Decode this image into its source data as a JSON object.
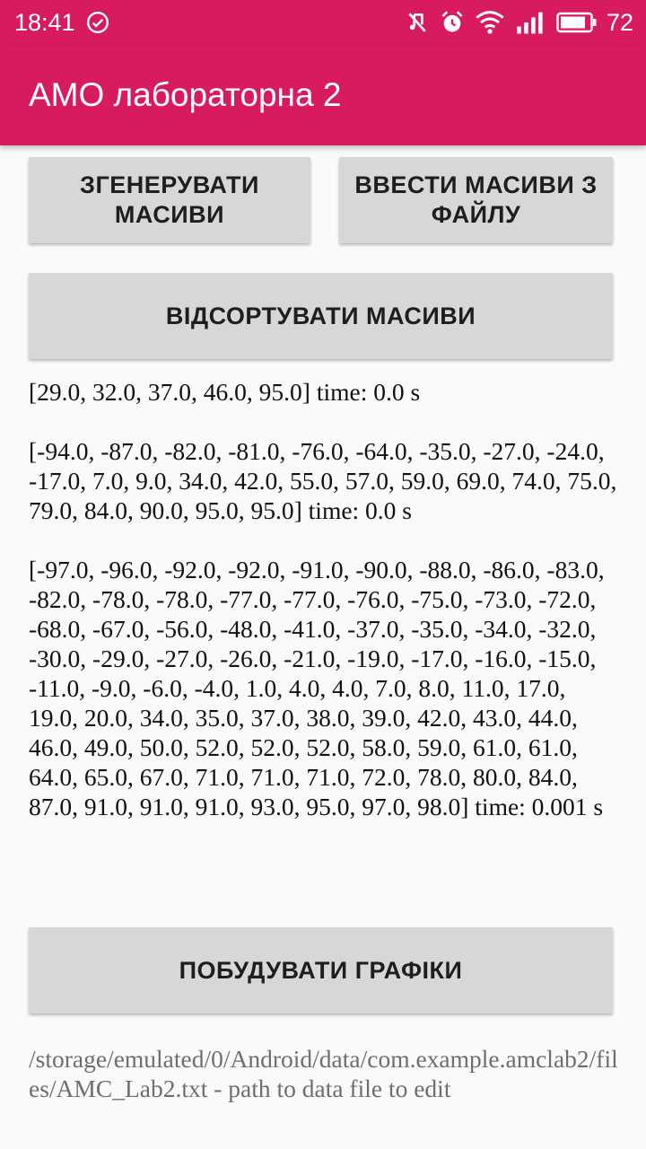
{
  "status_bar": {
    "time": "18:41",
    "battery": "72",
    "icons": [
      "check-circle-icon",
      "mute-icon",
      "alarm-icon",
      "wifi-icon",
      "signal-icon",
      "battery-icon"
    ]
  },
  "app": {
    "title": "AMO лабораторна 2",
    "accent_color": "#d81b60"
  },
  "buttons": {
    "generate": "ЗГЕНЕРУВАТИ МАСИВИ",
    "from_file": "ВВЕСТИ МАСИВИ З ФАЙЛУ",
    "sort": "ВІДСОРТУВАТИ МАСИВИ",
    "plot": "ПОБУДУВАТИ ГРАФІКИ"
  },
  "results": [
    "[29.0, 32.0, 37.0, 46.0, 95.0] time: 0.0 s",
    "[-94.0, -87.0, -82.0, -81.0, -76.0, -64.0, -35.0, -27.0, -24.0, -17.0, 7.0, 9.0, 34.0, 42.0, 55.0, 57.0, 59.0, 69.0, 74.0, 75.0, 79.0, 84.0, 90.0, 95.0, 95.0] time: 0.0 s",
    "[-97.0, -96.0, -92.0, -92.0, -91.0, -90.0, -88.0, -86.0, -83.0, -82.0, -78.0, -78.0, -77.0, -77.0, -76.0, -75.0, -73.0, -72.0, -68.0, -67.0, -56.0, -48.0, -41.0, -37.0, -35.0, -34.0, -32.0, -30.0, -29.0, -27.0, -26.0, -21.0, -19.0, -17.0, -16.0, -15.0, -11.0, -9.0, -6.0, -4.0, 1.0, 4.0, 4.0, 7.0, 8.0, 11.0, 17.0, 19.0, 20.0, 34.0, 35.0, 37.0, 38.0, 39.0, 42.0, 43.0, 44.0, 46.0, 49.0, 50.0, 52.0, 52.0, 52.0, 58.0, 59.0, 61.0, 61.0, 64.0, 65.0, 67.0, 71.0, 71.0, 71.0, 72.0, 78.0, 80.0, 84.0, 87.0, 91.0, 91.0, 91.0, 93.0, 95.0, 97.0, 98.0] time: 0.001 s"
  ],
  "path_text": "/storage/emulated/0/Android/data/com.example.amclab2/files/AMC_Lab2.txt - path to data file to edit"
}
